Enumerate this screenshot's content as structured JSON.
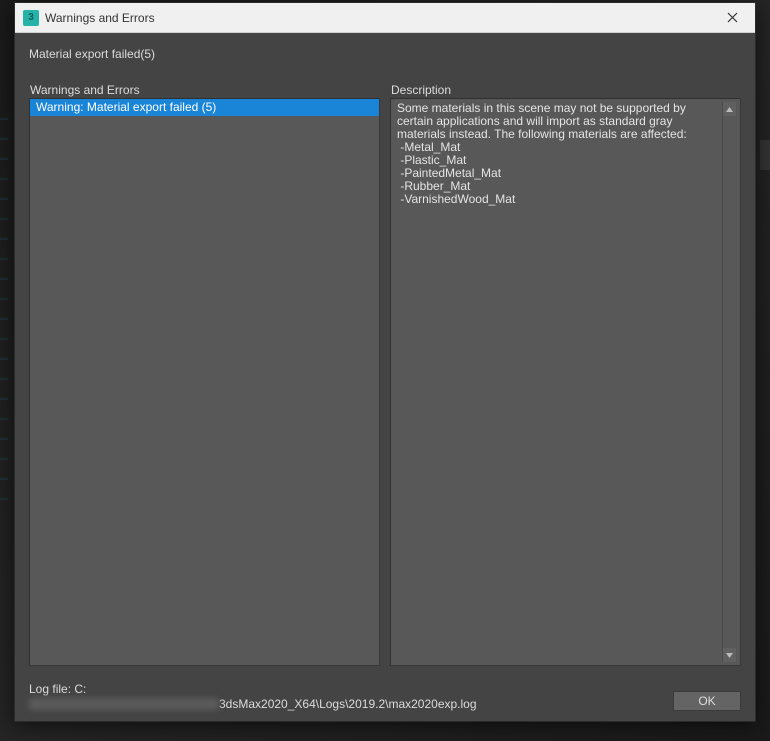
{
  "titlebar": {
    "app_icon_text": "3",
    "title": "Warnings and Errors"
  },
  "subtitle": "Material export failed(5)",
  "left_column": {
    "label": "Warnings and Errors",
    "items": [
      "Warning: Material export failed (5)"
    ]
  },
  "right_column": {
    "label": "Description",
    "text": "Some materials in this scene may not be supported by certain applications and will import as standard gray materials instead. The following materials are affected:\n -Metal_Mat\n -Plastic_Mat\n -PaintedMetal_Mat\n -Rubber_Mat\n -VarnishedWood_Mat"
  },
  "footer": {
    "log_label": "Log file: C:",
    "log_path_suffix": "3dsMax2020_X64\\Logs\\2019.2\\max2020exp.log",
    "ok_label": "OK"
  }
}
